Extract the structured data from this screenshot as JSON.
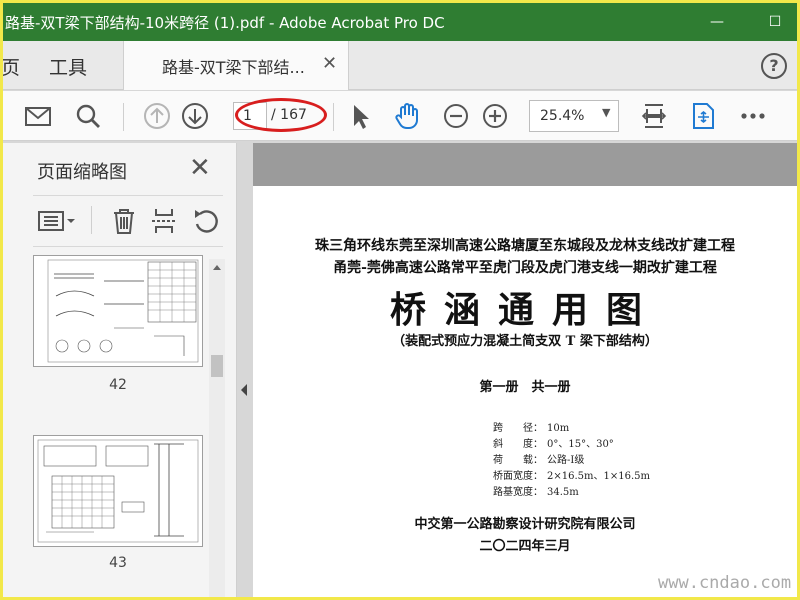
{
  "window": {
    "title": "路基-双T梁下部结构-10米跨径 (1).pdf - Adobe Acrobat Pro DC",
    "minimize": "—",
    "maximize": "☐"
  },
  "menu": {
    "home": "页",
    "tools": "工具"
  },
  "tab": {
    "label": "路基-双T梁下部结...",
    "close": "✕"
  },
  "help": "?",
  "toolbar": {
    "page_current": "1",
    "page_total": "/ 167",
    "zoom": "25.4%",
    "zoom_caret": "▼"
  },
  "panel": {
    "title": "页面缩略图",
    "close": "✕",
    "thumbnails": [
      {
        "number": "42"
      },
      {
        "number": "43"
      }
    ]
  },
  "document": {
    "line1": "珠三角环线东莞至深圳高速公路塘厦至东城段及龙林支线改扩建工程",
    "line2": "甬莞-莞佛高速公路常平至虎门段及虎门港支线一期改扩建工程",
    "title": "桥涵通用图",
    "subtitle": "（装配式预应力混凝土简支双 T 梁下部结构）",
    "volume": "第一册　共一册",
    "specs": [
      {
        "key": "跨　　径：",
        "value": "10m"
      },
      {
        "key": "斜　　度：",
        "value": "0°、15°、30°"
      },
      {
        "key": "荷　　载：",
        "value": "公路-Ⅰ级"
      },
      {
        "key": "桥面宽度：",
        "value": "2×16.5m、1×16.5m"
      },
      {
        "key": "路基宽度：",
        "value": "34.5m"
      }
    ],
    "organization": "中交第一公路勘察设计研究院有限公司",
    "date": "二〇二四年三月"
  },
  "watermark": "www.cndao.com",
  "colors": {
    "titlebar": "#2f7d32",
    "accent_blue": "#1f7ad2",
    "highlight_red": "#d81e1e"
  }
}
